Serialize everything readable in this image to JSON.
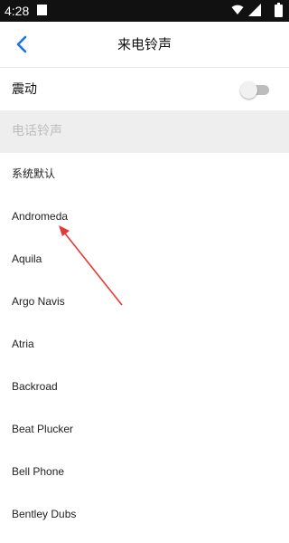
{
  "status_bar": {
    "time": "4:28",
    "icons": [
      "notification-icon",
      "wifi-icon",
      "signal-icon",
      "battery-icon"
    ]
  },
  "header": {
    "title": "来电铃声",
    "back_icon": "chevron-left-icon",
    "accent_color": "#1a73e8"
  },
  "vibrate": {
    "label": "震动",
    "enabled": false
  },
  "section": {
    "label": "电话铃声"
  },
  "ringtones": [
    "系统默认",
    "Andromeda",
    "Aquila",
    "Argo Navis",
    "Atria",
    "Backroad",
    "Beat Plucker",
    "Bell Phone",
    "Bentley Dubs"
  ],
  "annotation": {
    "color": "#e53935",
    "points_to": "Andromeda"
  }
}
